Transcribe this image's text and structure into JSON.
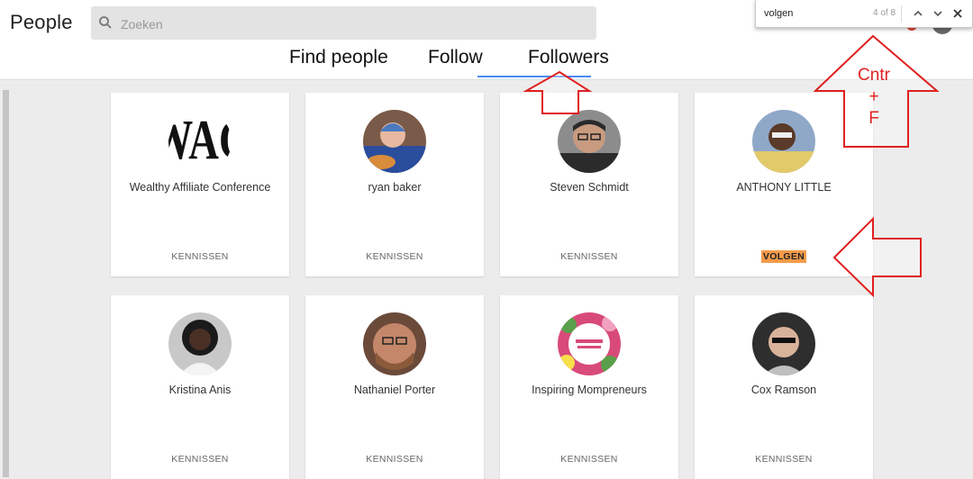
{
  "header": {
    "title": "People",
    "search_placeholder": "Zoeken"
  },
  "tabs": [
    {
      "label": "Find people"
    },
    {
      "label": "Follow"
    },
    {
      "label": "Followers",
      "active": true
    }
  ],
  "find_bar": {
    "query": "volgen",
    "count": "4 of 8"
  },
  "cards": [
    {
      "name": "Wealthy Affiliate Conference",
      "action": "KENNISSEN",
      "photo_icon": "wac-logo"
    },
    {
      "name": "ryan baker",
      "action": "KENNISSEN",
      "photo_icon": "person-photo"
    },
    {
      "name": "Steven Schmidt",
      "action": "KENNISSEN",
      "photo_icon": "person-photo"
    },
    {
      "name": "ANTHONY LITTLE",
      "action": "VOLGEN",
      "highlighted": true,
      "photo_icon": "person-photo"
    },
    {
      "name": "Kristina Anis",
      "action": "KENNISSEN",
      "photo_icon": "person-photo"
    },
    {
      "name": "Nathaniel Porter",
      "action": "KENNISSEN",
      "photo_icon": "person-photo"
    },
    {
      "name": "Inspiring Mompreneurs",
      "action": "KENNISSEN",
      "photo_icon": "floral-logo"
    },
    {
      "name": "Cox Ramson",
      "action": "KENNISSEN",
      "photo_icon": "person-photo"
    }
  ],
  "annotation": {
    "label_line1": "Cntr",
    "label_line2": "+",
    "label_line3": "F",
    "color": "#e02020"
  },
  "colors": {
    "tab_underline": "#4c8bf5",
    "highlight": "#f39b4a"
  }
}
